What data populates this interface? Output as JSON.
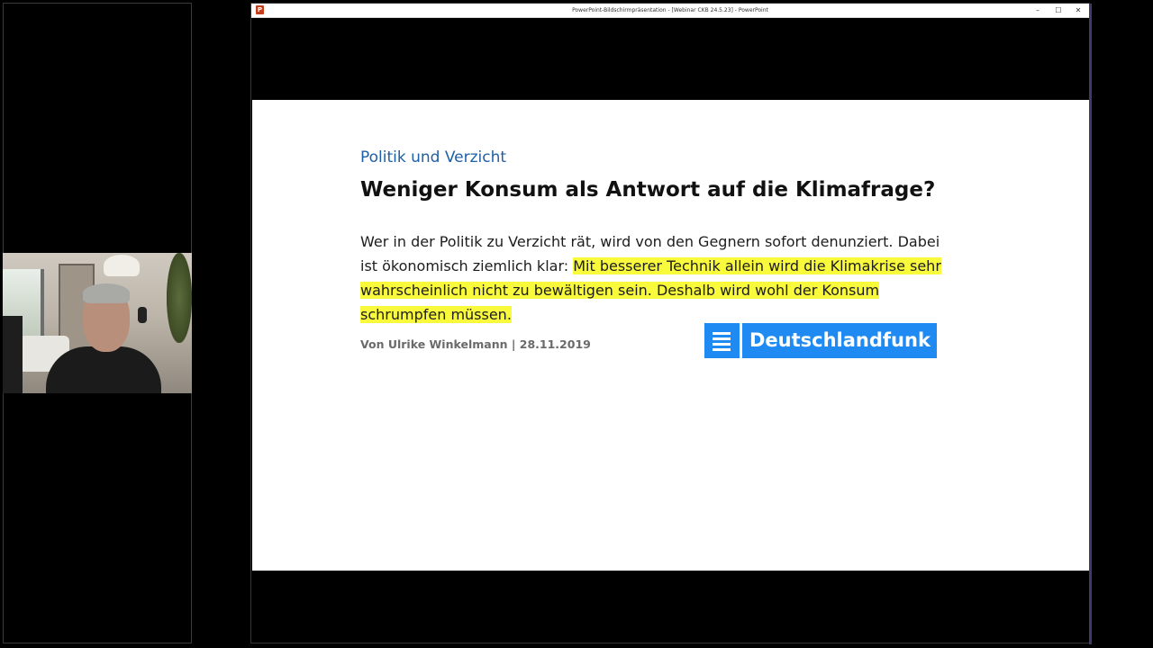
{
  "window": {
    "title": "PowerPoint-Bildschirmpräsentation - [Webinar CKB 24.5.23] - PowerPoint",
    "app_icon": "powerpoint-icon",
    "controls": {
      "minimize": "–",
      "maximize": "☐",
      "close": "✕"
    }
  },
  "slide": {
    "kicker": "Politik und Verzicht",
    "headline": "Weniger Konsum als Antwort auf die Klimafrage?",
    "teaser_plain": "Wer in der Politik zu Verzicht rät, wird von den Gegnern sofort denunziert. Dabei ist ökonomisch ziemlich klar: ",
    "teaser_highlighted": "Mit besserer Technik allein wird die Klimakrise sehr wahrscheinlich nicht zu bewältigen sein. Deshalb wird wohl der Konsum schrumpfen müssen.",
    "byline": "Von Ulrike Winkelmann | 28.11.2019",
    "logo_text": "Deutschlandfunk",
    "highlight_color": "#f9fa3b",
    "kicker_color": "#1f5fa6",
    "brand_color": "#1f8bf2"
  },
  "webcam": {
    "icon": "participant-video"
  }
}
